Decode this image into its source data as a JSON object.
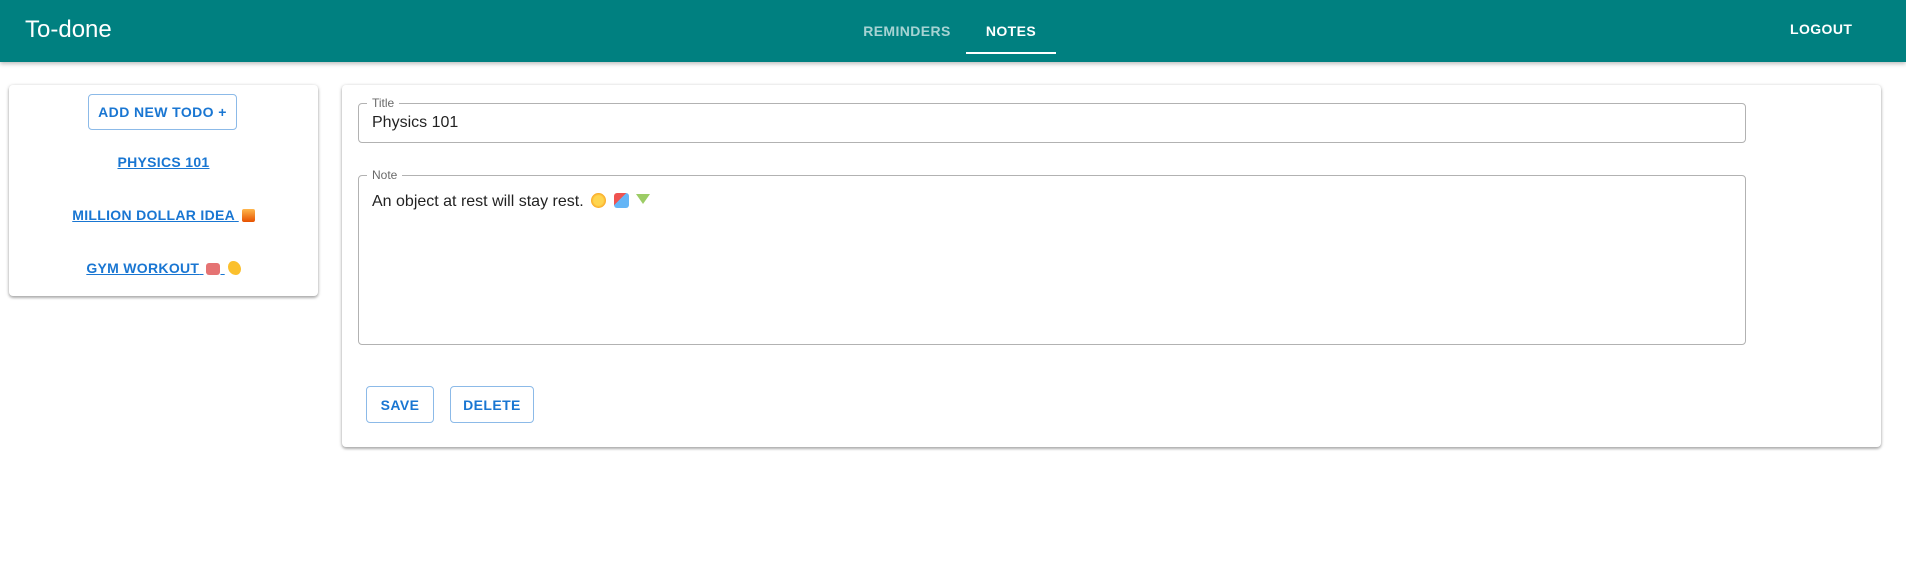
{
  "app": {
    "title": "To-done"
  },
  "nav": {
    "tabs": [
      {
        "label": "REMINDERS",
        "active": false
      },
      {
        "label": "NOTES",
        "active": true
      }
    ],
    "logout_label": "LOGOUT"
  },
  "sidebar": {
    "add_button_label": "ADD NEW TODO +",
    "items": [
      {
        "label": "PHYSICS 101",
        "icons": []
      },
      {
        "label": "MILLION DOLLAR IDEA",
        "icons": [
          "construction-emoji-icon"
        ]
      },
      {
        "label": "GYM WORKOUT",
        "icons": [
          "weightlifter-emoji-icon",
          "flexed-biceps-emoji-icon"
        ]
      }
    ]
  },
  "editor": {
    "title_label": "Title",
    "title_value": "Physics 101",
    "note_label": "Note",
    "note_value": "An object at rest will stay rest.",
    "note_icons": [
      "sun-emoji-icon",
      "beach-umbrella-emoji-icon",
      "cocktail-emoji-icon"
    ],
    "save_label": "SAVE",
    "delete_label": "DELETE"
  },
  "colors": {
    "appbar": "#008080",
    "primary": "#1976d2",
    "tab_inactive": "rgba(255,255,255,0.65)"
  }
}
